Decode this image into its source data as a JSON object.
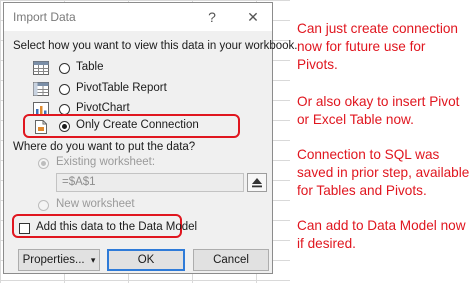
{
  "dialog": {
    "title": "Import Data",
    "help_glyph": "?",
    "close_glyph": "✕",
    "view_prompt": "Select how you want to view this data in your workbook.",
    "view_options": [
      {
        "label": "Table",
        "selected": false,
        "icon": "table-icon"
      },
      {
        "label": "PivotTable Report",
        "selected": false,
        "icon": "pivot-table-icon"
      },
      {
        "label": "PivotChart",
        "selected": false,
        "icon": "pivot-chart-icon"
      },
      {
        "label": "Only Create Connection",
        "selected": true,
        "icon": "connection-icon"
      }
    ],
    "location_prompt": "Where do you want to put the data?",
    "location_options": [
      {
        "label": "Existing worksheet:",
        "selected": true,
        "enabled": false
      },
      {
        "label": "New worksheet",
        "selected": false,
        "enabled": false
      }
    ],
    "cell_reference": "=$A$1",
    "data_model_label": "Add this data to the Data Model",
    "data_model_checked": false,
    "buttons": {
      "properties": "Properties...",
      "properties_arrow": "▾",
      "ok": "OK",
      "cancel": "Cancel"
    }
  },
  "notes": [
    {
      "lines": [
        "Can just create connection",
        "now for future use for",
        "Pivots."
      ]
    },
    {
      "lines": [
        "Or also okay to insert Pivot",
        "or Excel Table now."
      ]
    },
    {
      "lines": [
        "Connection to SQL was",
        "saved in prior step, available",
        "for Tables and Pivots."
      ]
    },
    {
      "lines": [
        "Can add to Data Model now",
        "if desired."
      ]
    }
  ],
  "colors": {
    "annotation_red": "#e0161f",
    "dialog_background": "#f0f0f0",
    "default_button_border": "#2f7bd8"
  }
}
